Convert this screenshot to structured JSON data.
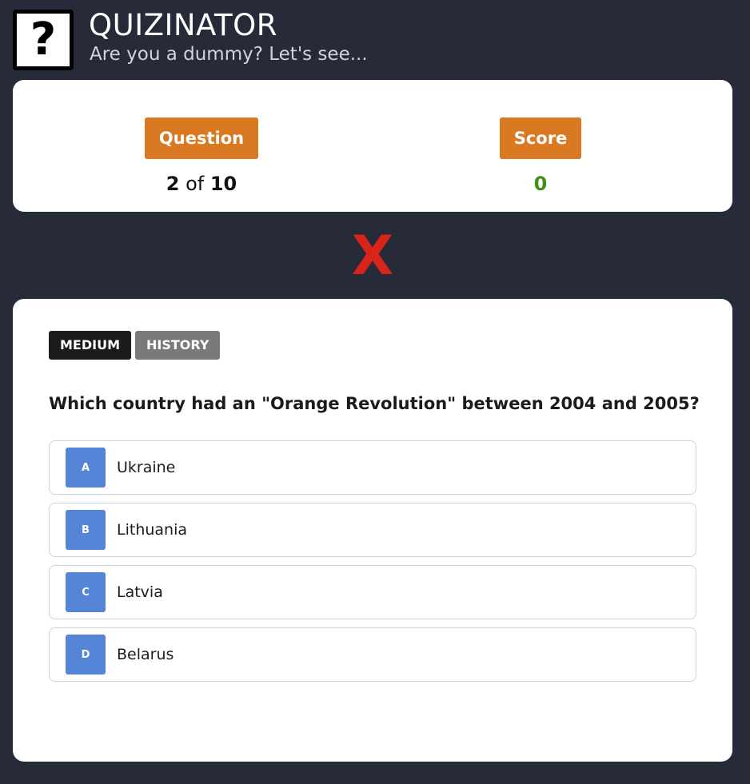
{
  "app": {
    "logo_glyph": "?",
    "title": "QUIZINATOR",
    "subtitle": "Are you a dummy? Let's see..."
  },
  "status": {
    "question_label": "Question",
    "question_current": "2",
    "question_of": "of",
    "question_total": "10",
    "score_label": "Score",
    "score_value": "0"
  },
  "feedback": {
    "mark": "X",
    "state": "wrong"
  },
  "question": {
    "difficulty": "MEDIUM",
    "category": "HISTORY",
    "text": "Which country had an \"Orange Revolution\" between 2004 and 2005?",
    "answers": [
      {
        "letter": "A",
        "text": "Ukraine"
      },
      {
        "letter": "B",
        "text": "Lithuania"
      },
      {
        "letter": "C",
        "text": "Latvia"
      },
      {
        "letter": "D",
        "text": "Belarus"
      }
    ]
  },
  "colors": {
    "background": "#272a38",
    "accent_orange": "#d97a22",
    "score_green": "#3f8f1b",
    "wrong_red": "#d8241b",
    "answer_letter_blue": "#5585d6",
    "tag_difficulty": "#1b1b1b",
    "tag_category": "#7a7a7a"
  },
  "icons": {
    "logo": "question-mark-icon",
    "feedback": "wrong-x-icon"
  }
}
